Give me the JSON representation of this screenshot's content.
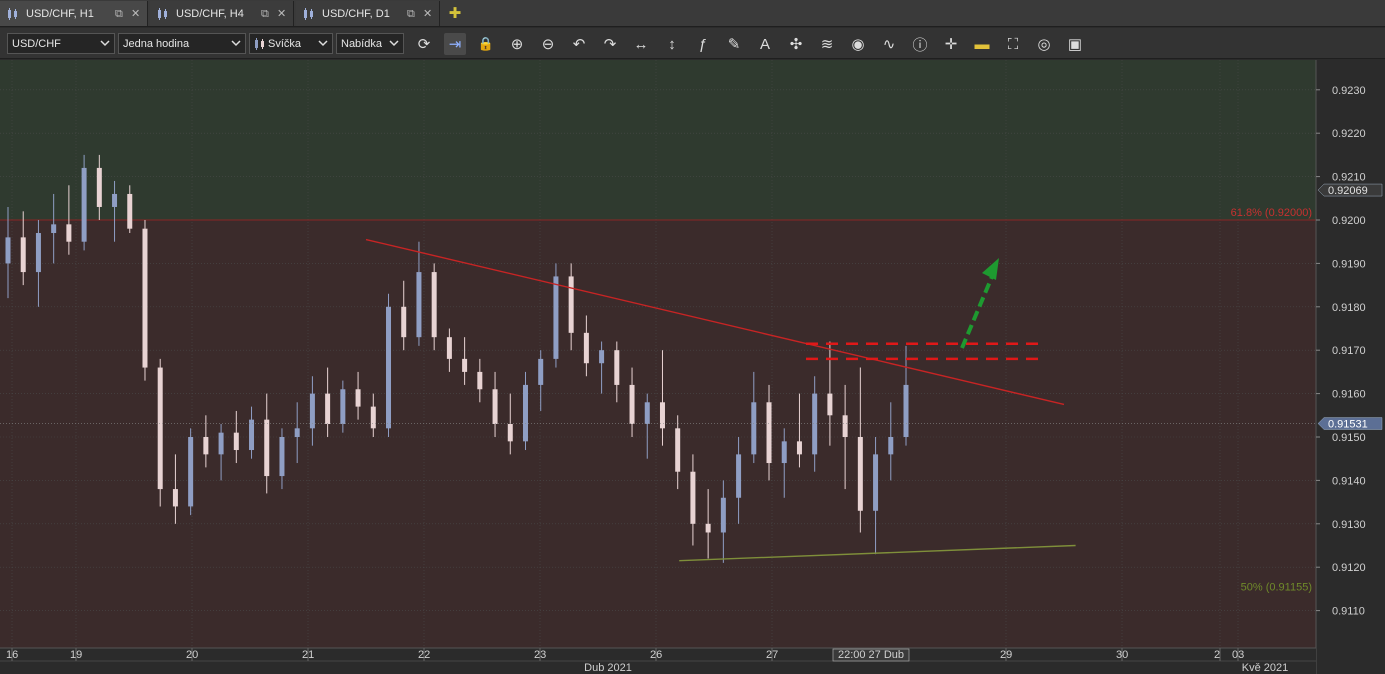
{
  "tabs": [
    {
      "label": "USD/CHF, H1",
      "active": true
    },
    {
      "label": "USD/CHF, H4",
      "active": false
    },
    {
      "label": "USD/CHF, D1",
      "active": false
    }
  ],
  "toolbar": {
    "instrument": "USD/CHF",
    "period": "Jedna hodina",
    "chart_type": "Svíčka",
    "price_side": "Nabídka",
    "tools": [
      "refresh-icon",
      "shift-chart-icon",
      "lock-icon",
      "zoom-in-icon",
      "zoom-out-icon",
      "undo-icon",
      "redo-icon",
      "horizontal-arrows-icon",
      "vertical-arrows-icon",
      "fx-indicators-icon",
      "pencil-draw-icon",
      "text-tool-icon",
      "crosshair-icon",
      "layers-icon",
      "eye-icon",
      "chart-pattern-icon",
      "info-icon",
      "cursor-mode-icon",
      "color-bar-icon",
      "fill-bucket-icon",
      "lifebuoy-icon",
      "save-icon"
    ]
  },
  "colors": {
    "upper_zone": "#2f3a2f",
    "lower_zone": "#3b2b2b",
    "bull": "#8f9ec4",
    "bear": "#e8d3d3",
    "trendline_red": "#c72424",
    "trendline_green": "#7f8f3a",
    "arrow_green": "#1e9a30",
    "dashed_red": "#e01818"
  },
  "axis": {
    "y_ticks": [
      "0.9230",
      "0.9220",
      "0.9210",
      "0.9200",
      "0.9190",
      "0.9180",
      "0.9170",
      "0.9160",
      "0.9150",
      "0.9140",
      "0.9130",
      "0.9120",
      "0.9110"
    ],
    "x_ticks": [
      "16",
      "19",
      "20",
      "21",
      "22",
      "23",
      "26",
      "27",
      "29",
      "30",
      "2",
      "03"
    ],
    "month_labels": [
      "Dub 2021",
      "Kvě 2021"
    ],
    "crosshair_time": "22:00 27 Dub",
    "current_price_label": "0.91531",
    "high_price_label": "0.92069",
    "fib_upper_label": "61.8% (0.92000)",
    "fib_lower_label": "50% (0.91155)"
  },
  "chart_data": {
    "type": "candlestick",
    "symbol": "USD/CHF",
    "timeframe": "H1",
    "ylim": [
      0.91,
      0.9235
    ],
    "current_price": 0.91531,
    "fib_levels": [
      {
        "label": "61.8%",
        "price": 0.92
      },
      {
        "label": "50%",
        "price": 0.91155
      }
    ],
    "candles": [
      [
        0.919,
        0.9203,
        0.9182,
        0.9196
      ],
      [
        0.9196,
        0.9202,
        0.9185,
        0.9188
      ],
      [
        0.9188,
        0.92,
        0.918,
        0.9197
      ],
      [
        0.9197,
        0.9206,
        0.919,
        0.9199
      ],
      [
        0.9199,
        0.9208,
        0.9192,
        0.9195
      ],
      [
        0.9195,
        0.9215,
        0.9193,
        0.9212
      ],
      [
        0.9212,
        0.9215,
        0.92,
        0.9203
      ],
      [
        0.9203,
        0.9209,
        0.9195,
        0.9206
      ],
      [
        0.9206,
        0.9208,
        0.9197,
        0.9198
      ],
      [
        0.9198,
        0.92,
        0.9163,
        0.9166
      ],
      [
        0.9166,
        0.9168,
        0.9134,
        0.9138
      ],
      [
        0.9138,
        0.9146,
        0.913,
        0.9134
      ],
      [
        0.9134,
        0.9152,
        0.9132,
        0.915
      ],
      [
        0.915,
        0.9155,
        0.9143,
        0.9146
      ],
      [
        0.9146,
        0.9153,
        0.914,
        0.9151
      ],
      [
        0.9151,
        0.9156,
        0.9144,
        0.9147
      ],
      [
        0.9147,
        0.9157,
        0.9145,
        0.9154
      ],
      [
        0.9154,
        0.916,
        0.9137,
        0.9141
      ],
      [
        0.9141,
        0.9152,
        0.9138,
        0.915
      ],
      [
        0.915,
        0.9158,
        0.9144,
        0.9152
      ],
      [
        0.9152,
        0.9164,
        0.9148,
        0.916
      ],
      [
        0.916,
        0.9166,
        0.915,
        0.9153
      ],
      [
        0.9153,
        0.9163,
        0.9151,
        0.9161
      ],
      [
        0.9161,
        0.9165,
        0.9154,
        0.9157
      ],
      [
        0.9157,
        0.916,
        0.915,
        0.9152
      ],
      [
        0.9152,
        0.9183,
        0.915,
        0.918
      ],
      [
        0.918,
        0.9186,
        0.917,
        0.9173
      ],
      [
        0.9173,
        0.9195,
        0.9171,
        0.9188
      ],
      [
        0.9188,
        0.919,
        0.917,
        0.9173
      ],
      [
        0.9173,
        0.9175,
        0.9165,
        0.9168
      ],
      [
        0.9168,
        0.9173,
        0.9162,
        0.9165
      ],
      [
        0.9165,
        0.9168,
        0.9158,
        0.9161
      ],
      [
        0.9161,
        0.9165,
        0.915,
        0.9153
      ],
      [
        0.9153,
        0.916,
        0.9146,
        0.9149
      ],
      [
        0.9149,
        0.9165,
        0.9147,
        0.9162
      ],
      [
        0.9162,
        0.917,
        0.9156,
        0.9168
      ],
      [
        0.9168,
        0.919,
        0.9166,
        0.9187
      ],
      [
        0.9187,
        0.919,
        0.917,
        0.9174
      ],
      [
        0.9174,
        0.9178,
        0.9164,
        0.9167
      ],
      [
        0.9167,
        0.9172,
        0.916,
        0.917
      ],
      [
        0.917,
        0.9172,
        0.9158,
        0.9162
      ],
      [
        0.9162,
        0.9166,
        0.915,
        0.9153
      ],
      [
        0.9153,
        0.916,
        0.9145,
        0.9158
      ],
      [
        0.9158,
        0.917,
        0.9148,
        0.9152
      ],
      [
        0.9152,
        0.9155,
        0.9138,
        0.9142
      ],
      [
        0.9142,
        0.9146,
        0.9125,
        0.913
      ],
      [
        0.913,
        0.9138,
        0.9122,
        0.9128
      ],
      [
        0.9128,
        0.914,
        0.9121,
        0.9136
      ],
      [
        0.9136,
        0.915,
        0.913,
        0.9146
      ],
      [
        0.9146,
        0.9165,
        0.9144,
        0.9158
      ],
      [
        0.9158,
        0.9162,
        0.914,
        0.9144
      ],
      [
        0.9144,
        0.9152,
        0.9136,
        0.9149
      ],
      [
        0.9149,
        0.916,
        0.9143,
        0.9146
      ],
      [
        0.9146,
        0.9164,
        0.9142,
        0.916
      ],
      [
        0.916,
        0.9172,
        0.9148,
        0.9155
      ],
      [
        0.9155,
        0.9162,
        0.9138,
        0.915
      ],
      [
        0.915,
        0.9166,
        0.9128,
        0.9133
      ],
      [
        0.9133,
        0.915,
        0.9123,
        0.9146
      ],
      [
        0.9146,
        0.9158,
        0.914,
        0.915
      ],
      [
        0.915,
        0.9171,
        0.9148,
        0.9162
      ]
    ],
    "trendlines": [
      {
        "name": "descending resistance",
        "from": [
          21.5,
          0.91955
        ],
        "to": [
          29.5,
          0.91575
        ]
      },
      {
        "name": "ascending support",
        "from": [
          26.2,
          0.91215
        ],
        "to": [
          29.6,
          0.9125
        ]
      }
    ],
    "dashed_levels": [
      0.91715,
      0.9168
    ]
  }
}
